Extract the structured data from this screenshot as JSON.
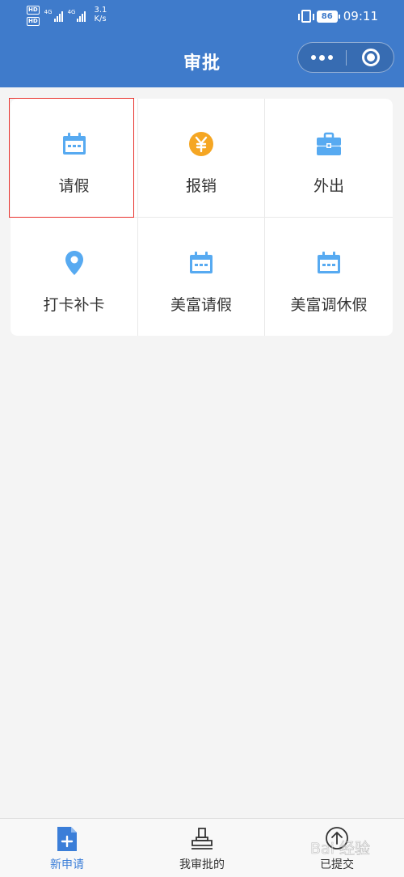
{
  "status_bar": {
    "hd_badges": [
      "HD",
      "HD"
    ],
    "network_labels": [
      "4G",
      "4G"
    ],
    "net_speed_value": "3.1",
    "net_speed_unit": "K/s",
    "battery_level": "86",
    "time": "09:11"
  },
  "header": {
    "title": "审批",
    "more_icon": "more-dots-icon",
    "close_icon": "mini-program-close-icon"
  },
  "colors": {
    "header_bg": "#3f7bcb",
    "icon_blue": "#57aaf1",
    "icon_orange": "#f5a623",
    "active_tab": "#3b7ed8",
    "highlight_border": "#e8322d"
  },
  "grid": {
    "items": [
      {
        "label": "请假",
        "icon": "calendar-icon"
      },
      {
        "label": "报销",
        "icon": "yuan-coin-icon"
      },
      {
        "label": "外出",
        "icon": "briefcase-icon"
      },
      {
        "label": "打卡补卡",
        "icon": "location-pin-icon"
      },
      {
        "label": "美富请假",
        "icon": "calendar-icon"
      },
      {
        "label": "美富调休假",
        "icon": "calendar-icon"
      }
    ]
  },
  "tab_bar": {
    "tabs": [
      {
        "label": "新申请",
        "icon": "new-document-icon",
        "active": true
      },
      {
        "label": "我审批的",
        "icon": "stamp-icon",
        "active": false
      },
      {
        "label": "已提交",
        "icon": "upload-arrow-icon",
        "active": false
      }
    ]
  },
  "watermark": {
    "text": "Bai 经验"
  }
}
